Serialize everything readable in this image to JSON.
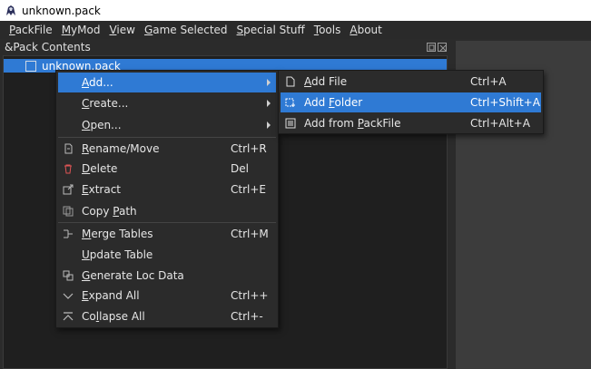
{
  "window": {
    "title": "unknown.pack"
  },
  "menubar": [
    {
      "pre": "",
      "u": "P",
      "post": "ackFile"
    },
    {
      "pre": "",
      "u": "M",
      "post": "yMod"
    },
    {
      "pre": "",
      "u": "V",
      "post": "iew"
    },
    {
      "pre": "",
      "u": "G",
      "post": "ame Selected"
    },
    {
      "pre": "",
      "u": "S",
      "post": "pecial Stuff"
    },
    {
      "pre": "",
      "u": "T",
      "post": "ools"
    },
    {
      "pre": "",
      "u": "A",
      "post": "bout"
    }
  ],
  "dock": {
    "title": "&Pack Contents"
  },
  "tree": {
    "root": "unknown.pack"
  },
  "context_menu": {
    "add": {
      "u": "A",
      "post": "dd..."
    },
    "create": {
      "u": "C",
      "post": "reate..."
    },
    "open": {
      "u": "O",
      "post": "pen..."
    },
    "rename": {
      "u": "R",
      "post": "ename/Move",
      "shortcut": "Ctrl+R"
    },
    "delete": {
      "u": "D",
      "post": "elete",
      "shortcut": "Del"
    },
    "extract": {
      "u": "E",
      "post": "xtract",
      "shortcut": "Ctrl+E"
    },
    "copy_path": {
      "pre": "Copy ",
      "u": "P",
      "post": "ath"
    },
    "merge_tables": {
      "u": "M",
      "post": "erge Tables",
      "shortcut": "Ctrl+M"
    },
    "update_table": {
      "u": "U",
      "post": "pdate Table"
    },
    "generate_loc": {
      "u": "G",
      "post": "enerate Loc Data"
    },
    "expand_all": {
      "u": "E",
      "post": "xpand All",
      "shortcut": "Ctrl++"
    },
    "collapse_all": {
      "pre": "Co",
      "u": "l",
      "post": "lapse All",
      "shortcut": "Ctrl+-"
    }
  },
  "submenu": {
    "add_file": {
      "pre": "",
      "u": "A",
      "post": "dd File",
      "shortcut": "Ctrl+A"
    },
    "add_folder": {
      "pre": "Add ",
      "u": "F",
      "post": "older",
      "shortcut": "Ctrl+Shift+A"
    },
    "add_from_packfile": {
      "pre": "Add from ",
      "u": "P",
      "post": "ackFile",
      "shortcut": "Ctrl+Alt+A"
    }
  }
}
